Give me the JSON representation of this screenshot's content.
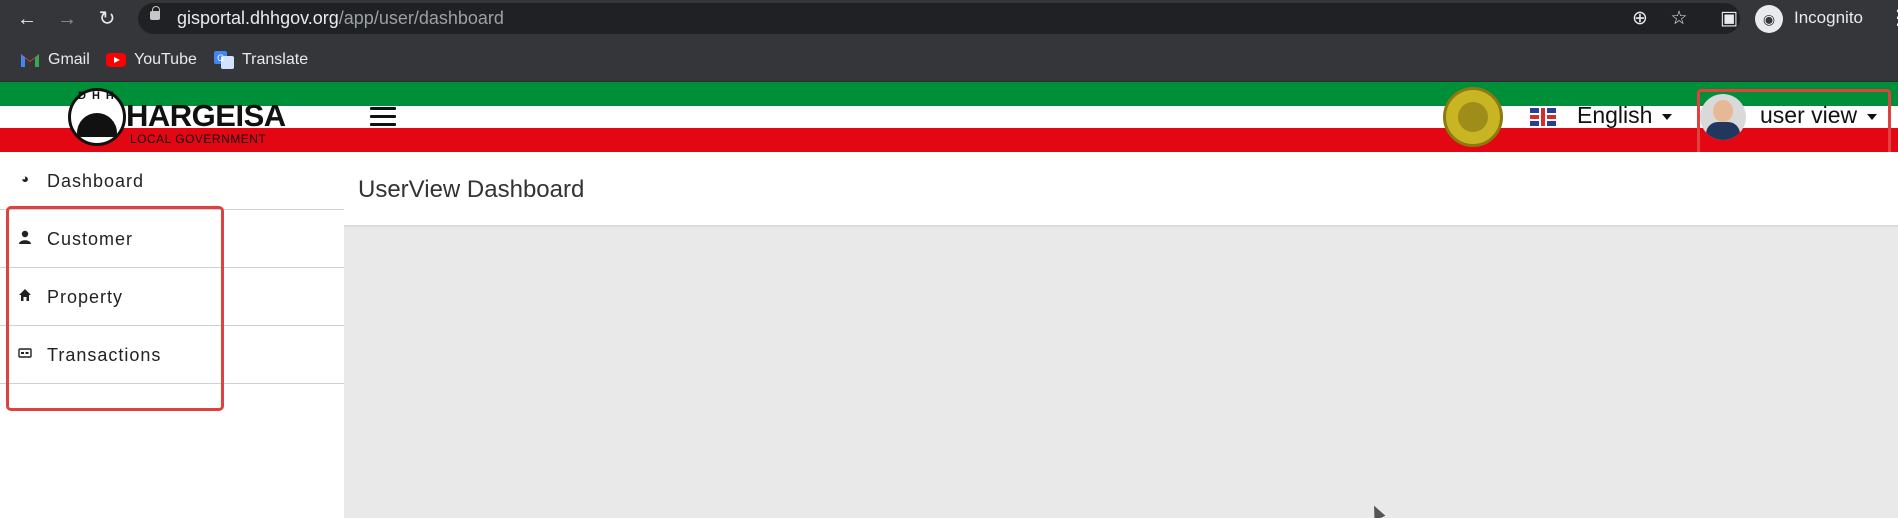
{
  "browser": {
    "url_host": "gisportal.dhhgov.org",
    "url_path": "/app/user/dashboard",
    "incognito_label": "Incognito",
    "bookmarks": [
      {
        "label": "Gmail",
        "icon": "gmail-icon"
      },
      {
        "label": "YouTube",
        "icon": "youtube-icon"
      },
      {
        "label": "Translate",
        "icon": "translate-icon"
      }
    ]
  },
  "header": {
    "logo_initials": "DHH",
    "logo_title": "HARGEISA",
    "logo_subtitle": "LOCAL GOVERNMENT",
    "language": "English",
    "user_name": "user view",
    "colors": {
      "green": "#008f39",
      "white": "#ffffff",
      "red": "#e30613",
      "highlight": "#e04040"
    }
  },
  "sidebar": {
    "items": [
      {
        "label": "Dashboard",
        "icon": "dashboard-icon"
      },
      {
        "label": "Customer",
        "icon": "user-icon"
      },
      {
        "label": "Property",
        "icon": "home-icon"
      },
      {
        "label": "Transactions",
        "icon": "card-icon"
      }
    ]
  },
  "main": {
    "title": "UserView Dashboard"
  }
}
